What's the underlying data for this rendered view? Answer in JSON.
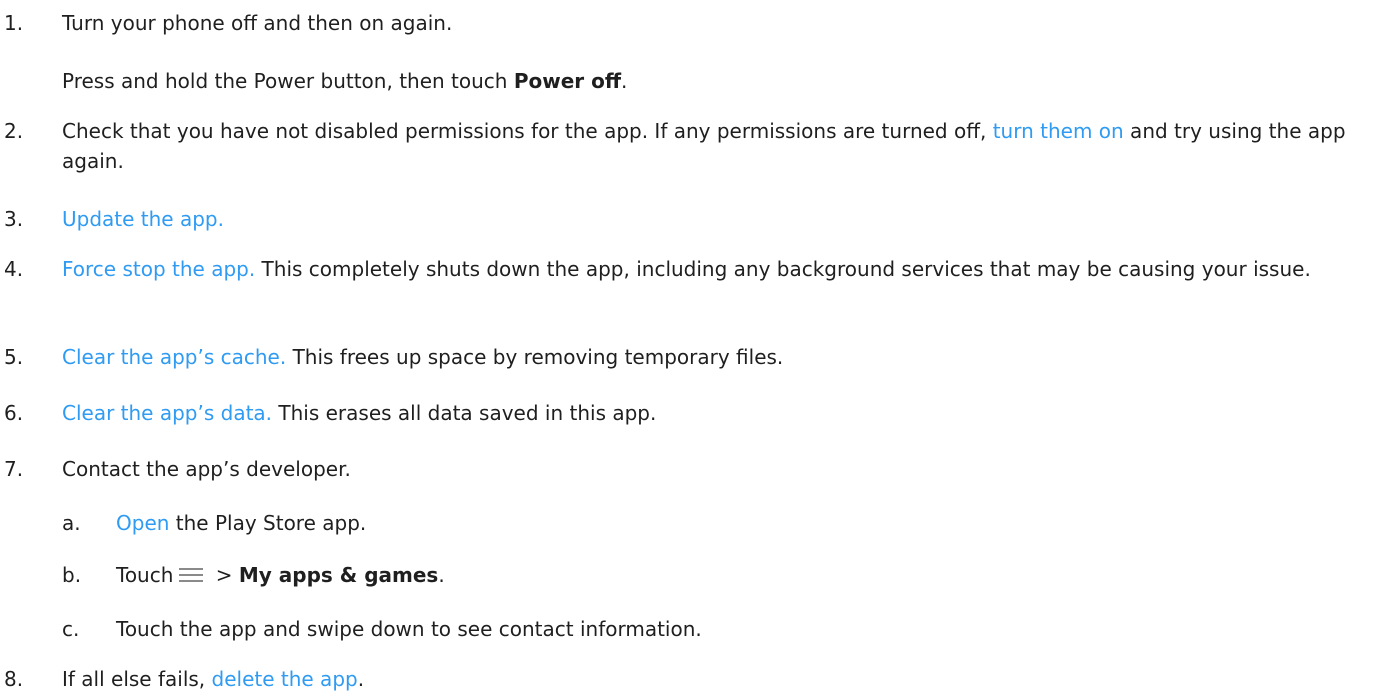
{
  "steps": [
    {
      "num": "1.",
      "text": "Turn your phone off and then on again.",
      "sub_pre": "Press and hold the Power button, then touch ",
      "sub_bold": "Power off",
      "sub_post": "."
    },
    {
      "num": "2.",
      "pre": "Check that you have not disabled permissions for the app. If any permissions are turned off, ",
      "link": "turn them on",
      "post": " and try using the app again."
    },
    {
      "num": "3.",
      "link": "Update the app."
    },
    {
      "num": "4.",
      "link": "Force stop the app.",
      "post": " This completely shuts down the app, including any background services that may be causing your issue."
    },
    {
      "num": "5.",
      "link": "Clear the app’s cache.",
      "post": " This frees up space by removing temporary files."
    },
    {
      "num": "6.",
      "link": "Clear the app’s data.",
      "post": " This erases all data saved in this app."
    },
    {
      "num": "7.",
      "text": "Contact the app’s developer.",
      "substeps": [
        {
          "num": "a.",
          "link": "Open",
          "post": " the Play Store app."
        },
        {
          "num": "b.",
          "pre": "Touch",
          "icon": "menu-icon",
          "mid": " > ",
          "bold": "My apps & games",
          "post": "."
        },
        {
          "num": "c.",
          "text": "Touch the app and swipe down to see contact information."
        }
      ]
    },
    {
      "num": "8.",
      "pre": "If all else fails, ",
      "link": "delete the app",
      "post": "."
    }
  ],
  "colors": {
    "text": "#1f1f1f",
    "link": "#2f9bf2",
    "icon": "#8a8a8a"
  }
}
